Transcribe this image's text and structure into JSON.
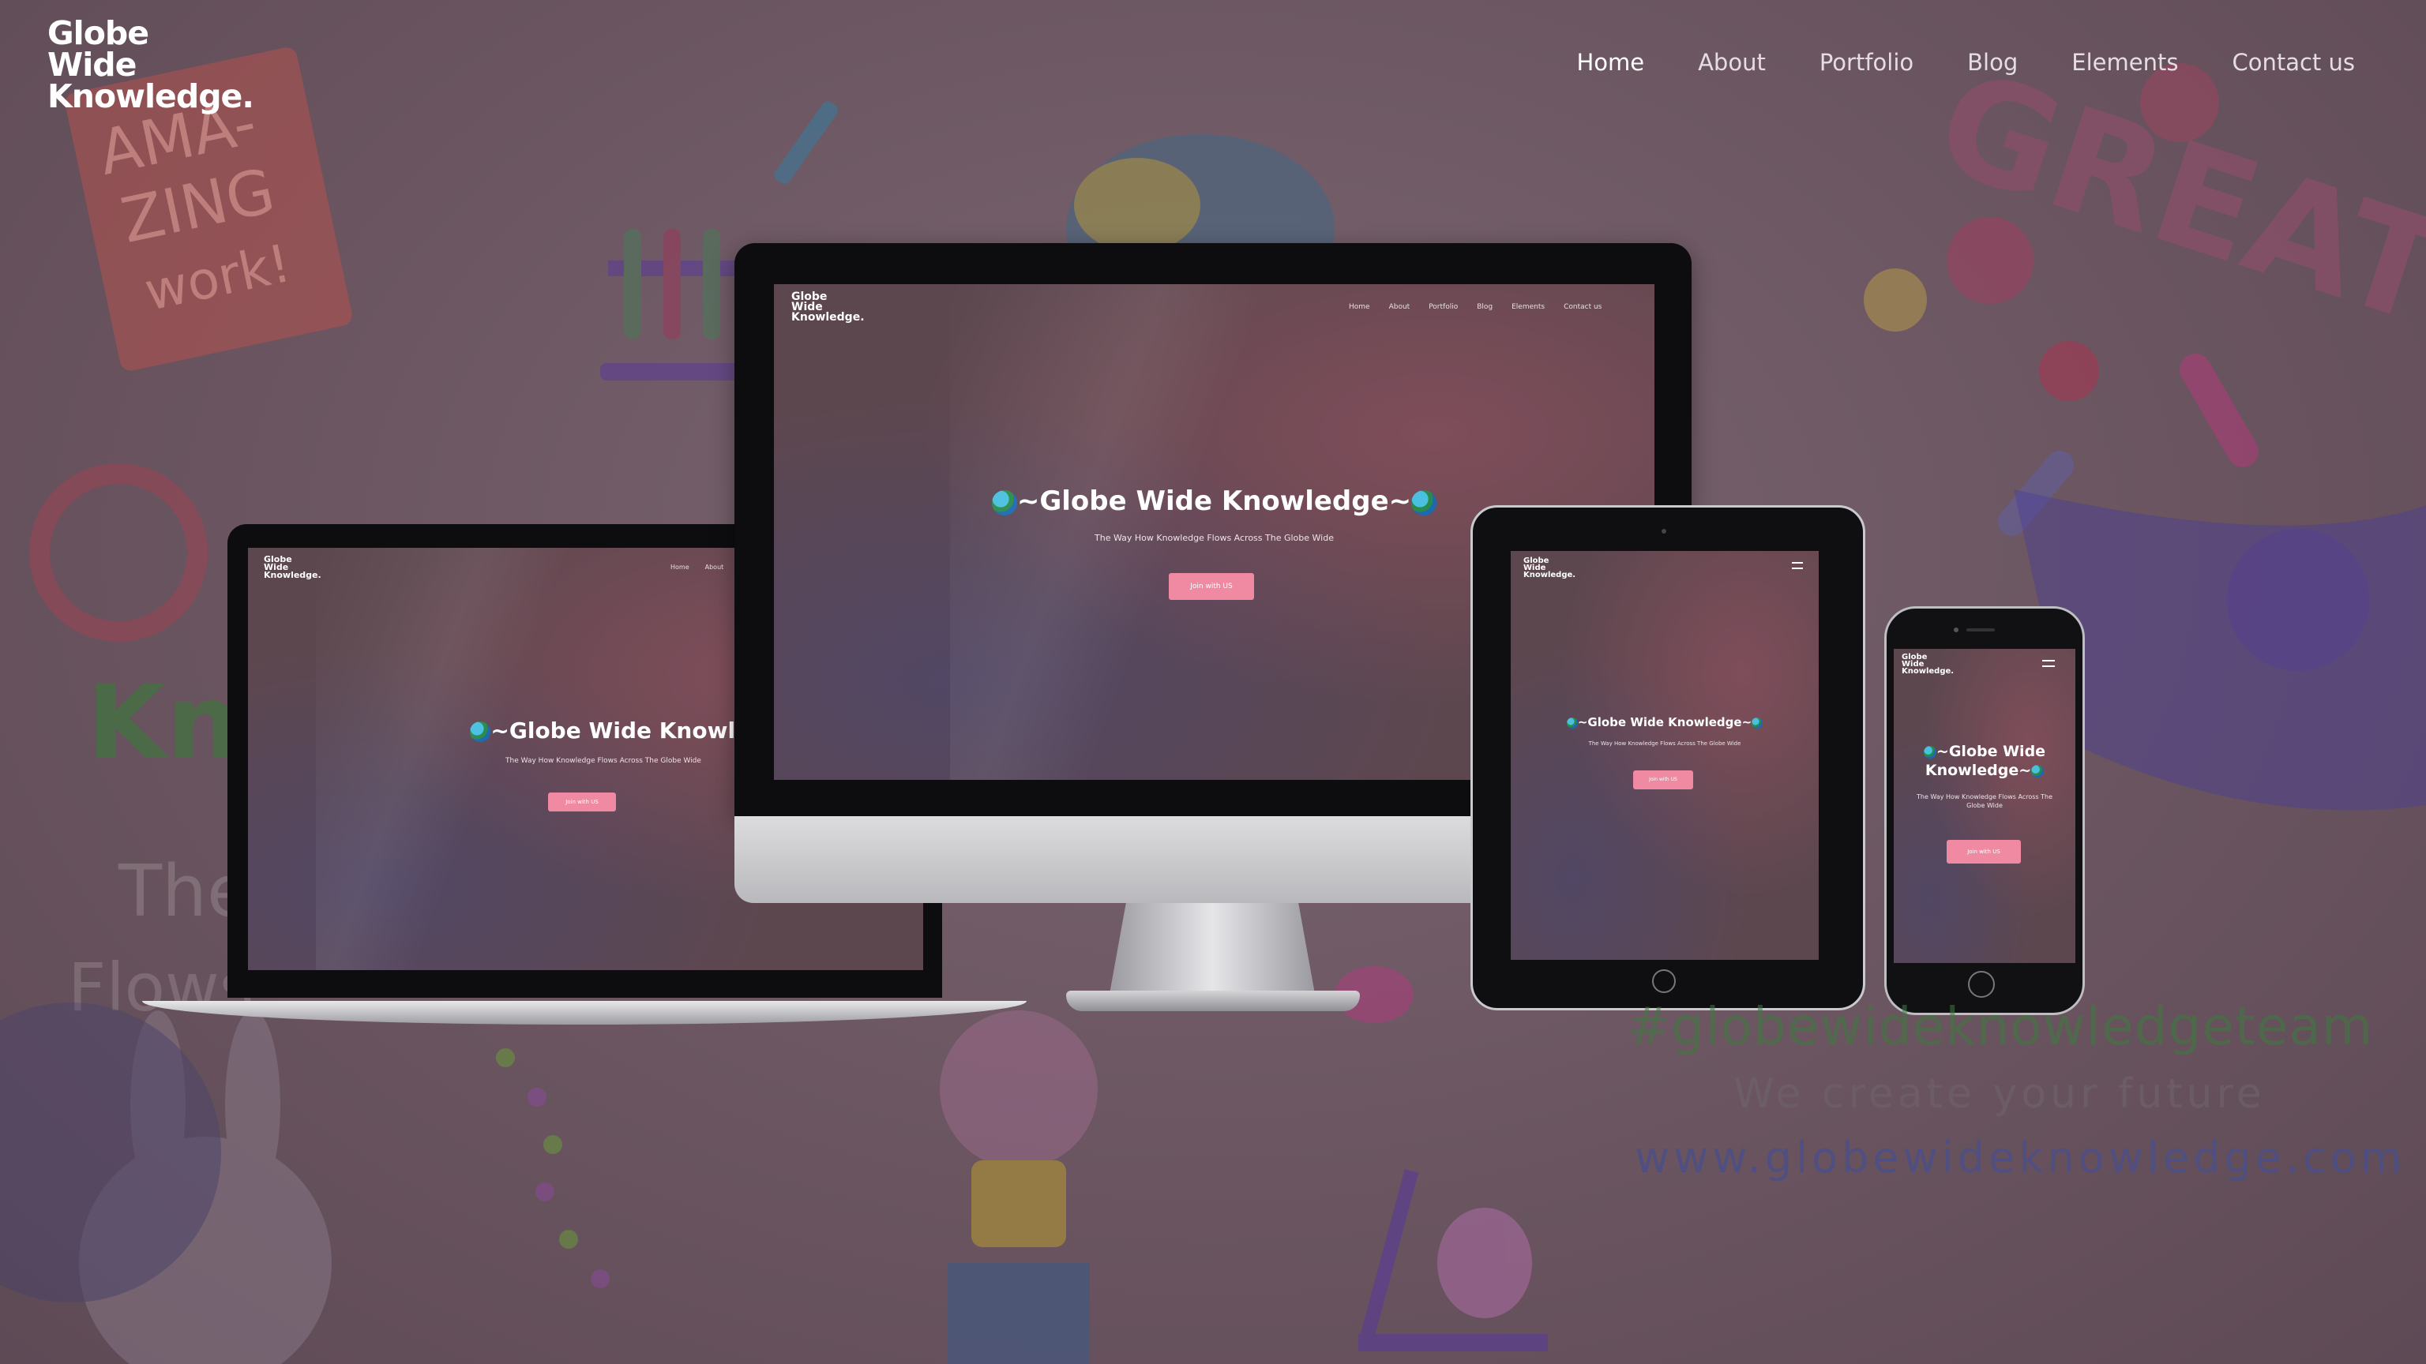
{
  "brand": {
    "line1": "Globe",
    "line2": "Wide",
    "line3": "Knowledge."
  },
  "nav": {
    "items": [
      "Home",
      "About",
      "Portfolio",
      "Blog",
      "Elements",
      "Contact us"
    ],
    "active": "Home"
  },
  "hero": {
    "title": "~Globe Wide Knowledge~",
    "subtitle": "The Way How Knowledge Flows Across The Globe Wide",
    "cta": "Join with US"
  },
  "bg_text": {
    "hashtag": "#globewideknowledgeteam",
    "tagline": "We create your future",
    "url": "www.globewideknowledge.com",
    "great": "GREAT",
    "amazing_line1": "AMA-",
    "amazing_line2": "ZING",
    "amazing_line3": "work!"
  },
  "colors": {
    "accent": "#f08aa2",
    "background": "#6a5560",
    "text": "#ffffff"
  },
  "icons": [
    "globe-icon",
    "menu-icon",
    "home-button-icon",
    "camera-icon"
  ]
}
